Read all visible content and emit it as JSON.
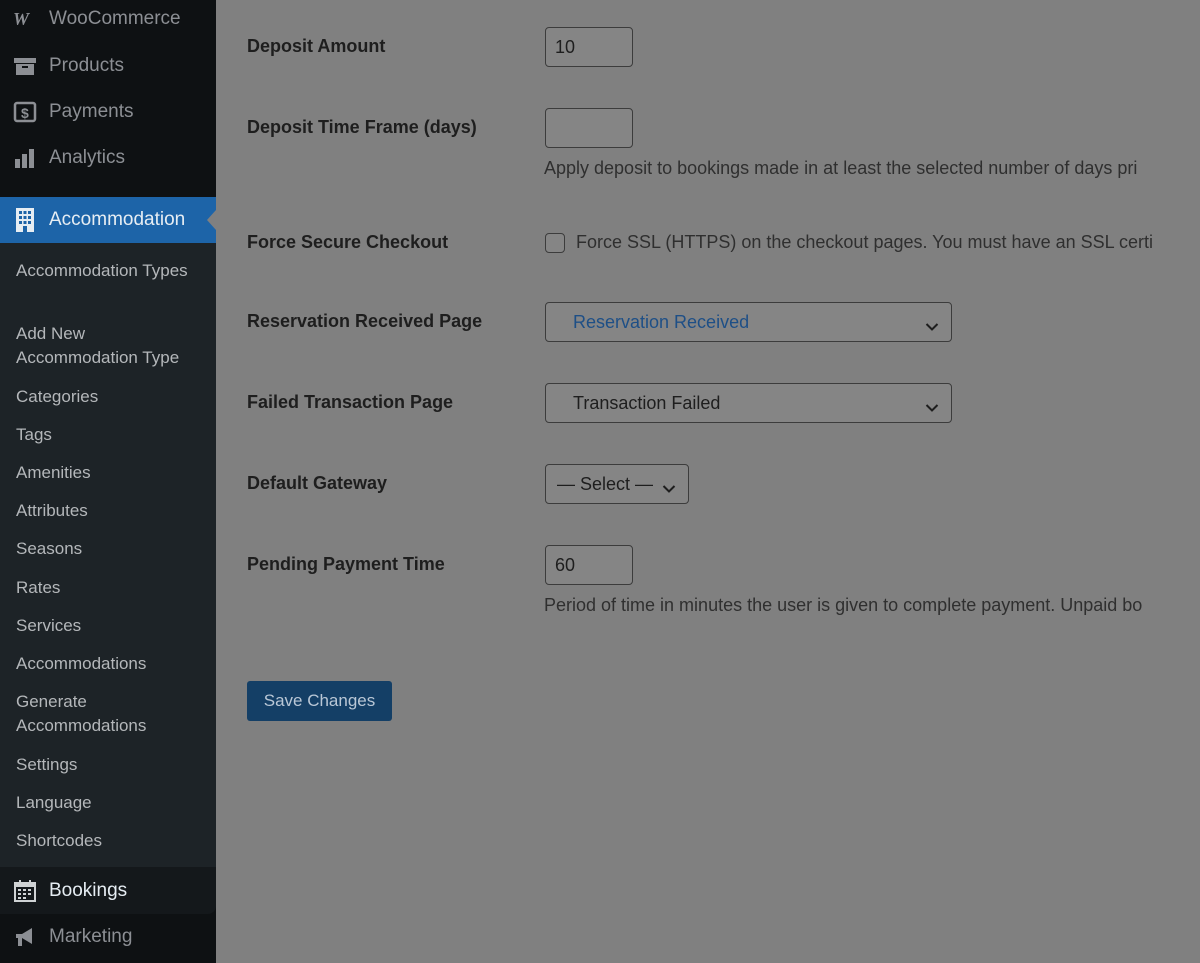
{
  "sidebar": {
    "menu": [
      {
        "label": "WooCommerce",
        "icon": "woocommerce-icon"
      },
      {
        "label": "Products",
        "icon": "archive-box-icon"
      },
      {
        "label": "Payments",
        "icon": "dollar-icon"
      },
      {
        "label": "Analytics",
        "icon": "bar-chart-icon"
      },
      {
        "label": "Accommodation",
        "icon": "building-icon"
      }
    ],
    "submenu": [
      "Accommodation Types",
      "Add New Accommodation Type",
      "Categories",
      "Tags",
      "Amenities",
      "Attributes",
      "Seasons",
      "Rates",
      "Services",
      "Accommodations",
      "Generate Accommodations",
      "Settings",
      "Language",
      "Shortcodes"
    ],
    "bottom": [
      {
        "label": "Bookings",
        "icon": "calendar-icon"
      },
      {
        "label": "Marketing",
        "icon": "megaphone-icon"
      }
    ]
  },
  "form": {
    "deposit_amount": {
      "label": "Deposit Amount",
      "value": "10"
    },
    "deposit_time_frame": {
      "label": "Deposit Time Frame (days)",
      "value": "",
      "description": "Apply deposit to bookings made in at least the selected number of days pri"
    },
    "force_secure_checkout": {
      "label": "Force Secure Checkout",
      "checkbox_label": "Force SSL (HTTPS) on the checkout pages. You must have an SSL certi"
    },
    "reservation_received_page": {
      "label": "Reservation Received Page",
      "value": "Reservation Received"
    },
    "failed_transaction_page": {
      "label": "Failed Transaction Page",
      "value": "Transaction Failed"
    },
    "default_gateway": {
      "label": "Default Gateway",
      "value": "— Select —"
    },
    "pending_payment_time": {
      "label": "Pending Payment Time",
      "value": "60",
      "description": "Period of time in minutes the user is given to complete payment. Unpaid bo"
    },
    "save_label": "Save Changes"
  },
  "colors": {
    "active_menu": "#1d64a8",
    "link_text": "#1e4f86",
    "save_button": "#143f66"
  }
}
